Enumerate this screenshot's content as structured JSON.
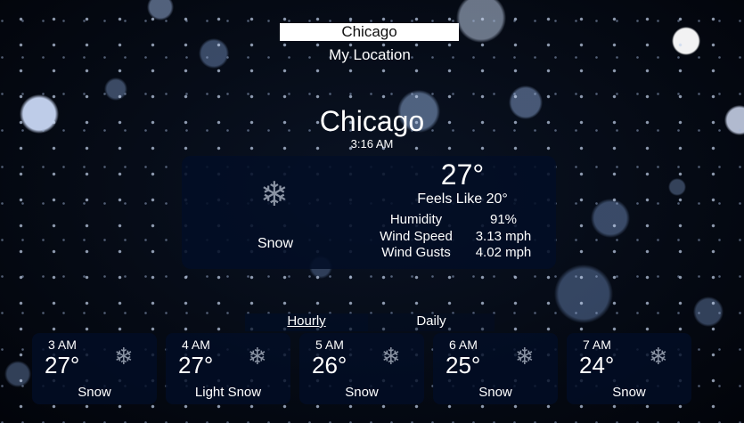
{
  "search": {
    "value": "Chicago"
  },
  "my_location_label": "My Location",
  "current": {
    "city": "Chicago",
    "time": "3:16 AM",
    "temperature": "27°",
    "feels_like": "Feels Like 20°",
    "condition": "Snow",
    "icon": "snowflake-icon",
    "stats": [
      {
        "label": "Humidity",
        "value": "91%"
      },
      {
        "label": "Wind Speed",
        "value": "3.13 mph"
      },
      {
        "label": "Wind Gusts",
        "value": "4.02 mph"
      }
    ]
  },
  "tabs": {
    "hourly": "Hourly",
    "daily": "Daily"
  },
  "forecast": [
    {
      "time": "3 AM",
      "temp": "27°",
      "condition": "Snow",
      "icon": "snowflake-icon"
    },
    {
      "time": "4 AM",
      "temp": "27°",
      "condition": "Light Snow",
      "icon": "snowflake-icon"
    },
    {
      "time": "5 AM",
      "temp": "26°",
      "condition": "Snow",
      "icon": "snowflake-icon"
    },
    {
      "time": "6 AM",
      "temp": "25°",
      "condition": "Snow",
      "icon": "snowflake-icon"
    },
    {
      "time": "7 AM",
      "temp": "24°",
      "condition": "Snow",
      "icon": "snowflake-icon"
    }
  ]
}
